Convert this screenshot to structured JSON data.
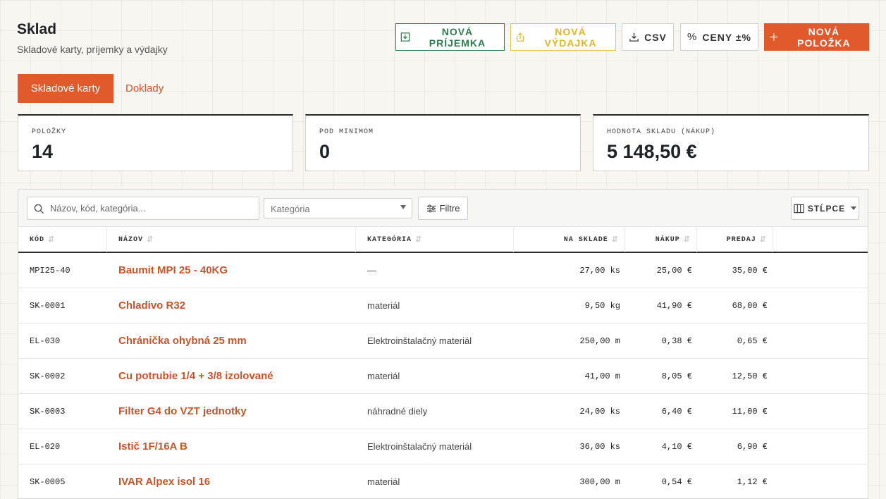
{
  "header": {
    "title": "Sklad",
    "subtitle": "Skladové karty, príjemky a výdajky"
  },
  "actions": {
    "new_receipt": "NOVÁ PRÍJEMKA",
    "new_issue": "NOVÁ VÝDAJKA",
    "csv": "CSV",
    "prices": "CENY ±%",
    "new_item": "NOVÁ POLOŽKA"
  },
  "tabs": {
    "active": "Skladové karty",
    "inactive": "Doklady"
  },
  "stats": [
    {
      "label": "POLOŽKY",
      "value": "14"
    },
    {
      "label": "POD MINIMOM",
      "value": "0"
    },
    {
      "label": "HODNOTA SKLADU (NÁKUP)",
      "value": "5 148,50 €"
    }
  ],
  "toolbar": {
    "search_placeholder": "Názov, kód, kategória...",
    "category_placeholder": "Kategória",
    "filters_label": "Filtre",
    "columns_label": "STĹPCE"
  },
  "table": {
    "columns": [
      "KÓD",
      "NÁZOV",
      "KATEGÓRIA",
      "NA SKLADE",
      "NÁKUP",
      "PREDAJ"
    ],
    "sort_glyph": "⇵",
    "rows": [
      {
        "code": "MPI25-40",
        "name": "Baumit MPI 25 - 40KG",
        "category": "—",
        "qty": "27,00 ks",
        "buy": "25,00 €",
        "sell": "35,00 €"
      },
      {
        "code": "SK-0001",
        "name": "Chladivo R32",
        "category": "materiál",
        "qty": "9,50 kg",
        "buy": "41,90 €",
        "sell": "68,00 €"
      },
      {
        "code": "EL-030",
        "name": "Chránička ohybná 25 mm",
        "category": "Elektroinštalačný materiál",
        "qty": "250,00 m",
        "buy": "0,38 €",
        "sell": "0,65 €"
      },
      {
        "code": "SK-0002",
        "name": "Cu potrubie 1/4 + 3/8 izolované",
        "category": "materiál",
        "qty": "41,00 m",
        "buy": "8,05 €",
        "sell": "12,50 €"
      },
      {
        "code": "SK-0003",
        "name": "Filter G4 do VZT jednotky",
        "category": "náhradné diely",
        "qty": "24,00 ks",
        "buy": "6,40 €",
        "sell": "11,00 €"
      },
      {
        "code": "EL-020",
        "name": "Istič 1F/16A B",
        "category": "Elektroinštalačný materiál",
        "qty": "36,00 ks",
        "buy": "4,10 €",
        "sell": "6,90 €"
      },
      {
        "code": "SK-0005",
        "name": "IVAR Alpex isol 16",
        "category": "materiál",
        "qty": "300,00 m",
        "buy": "0,54 €",
        "sell": "1,12 €"
      }
    ]
  },
  "colors": {
    "accent": "#e05a2b",
    "link": "#c9542a",
    "receipt": "#2f7a4f",
    "issue": "#e0b52a"
  }
}
